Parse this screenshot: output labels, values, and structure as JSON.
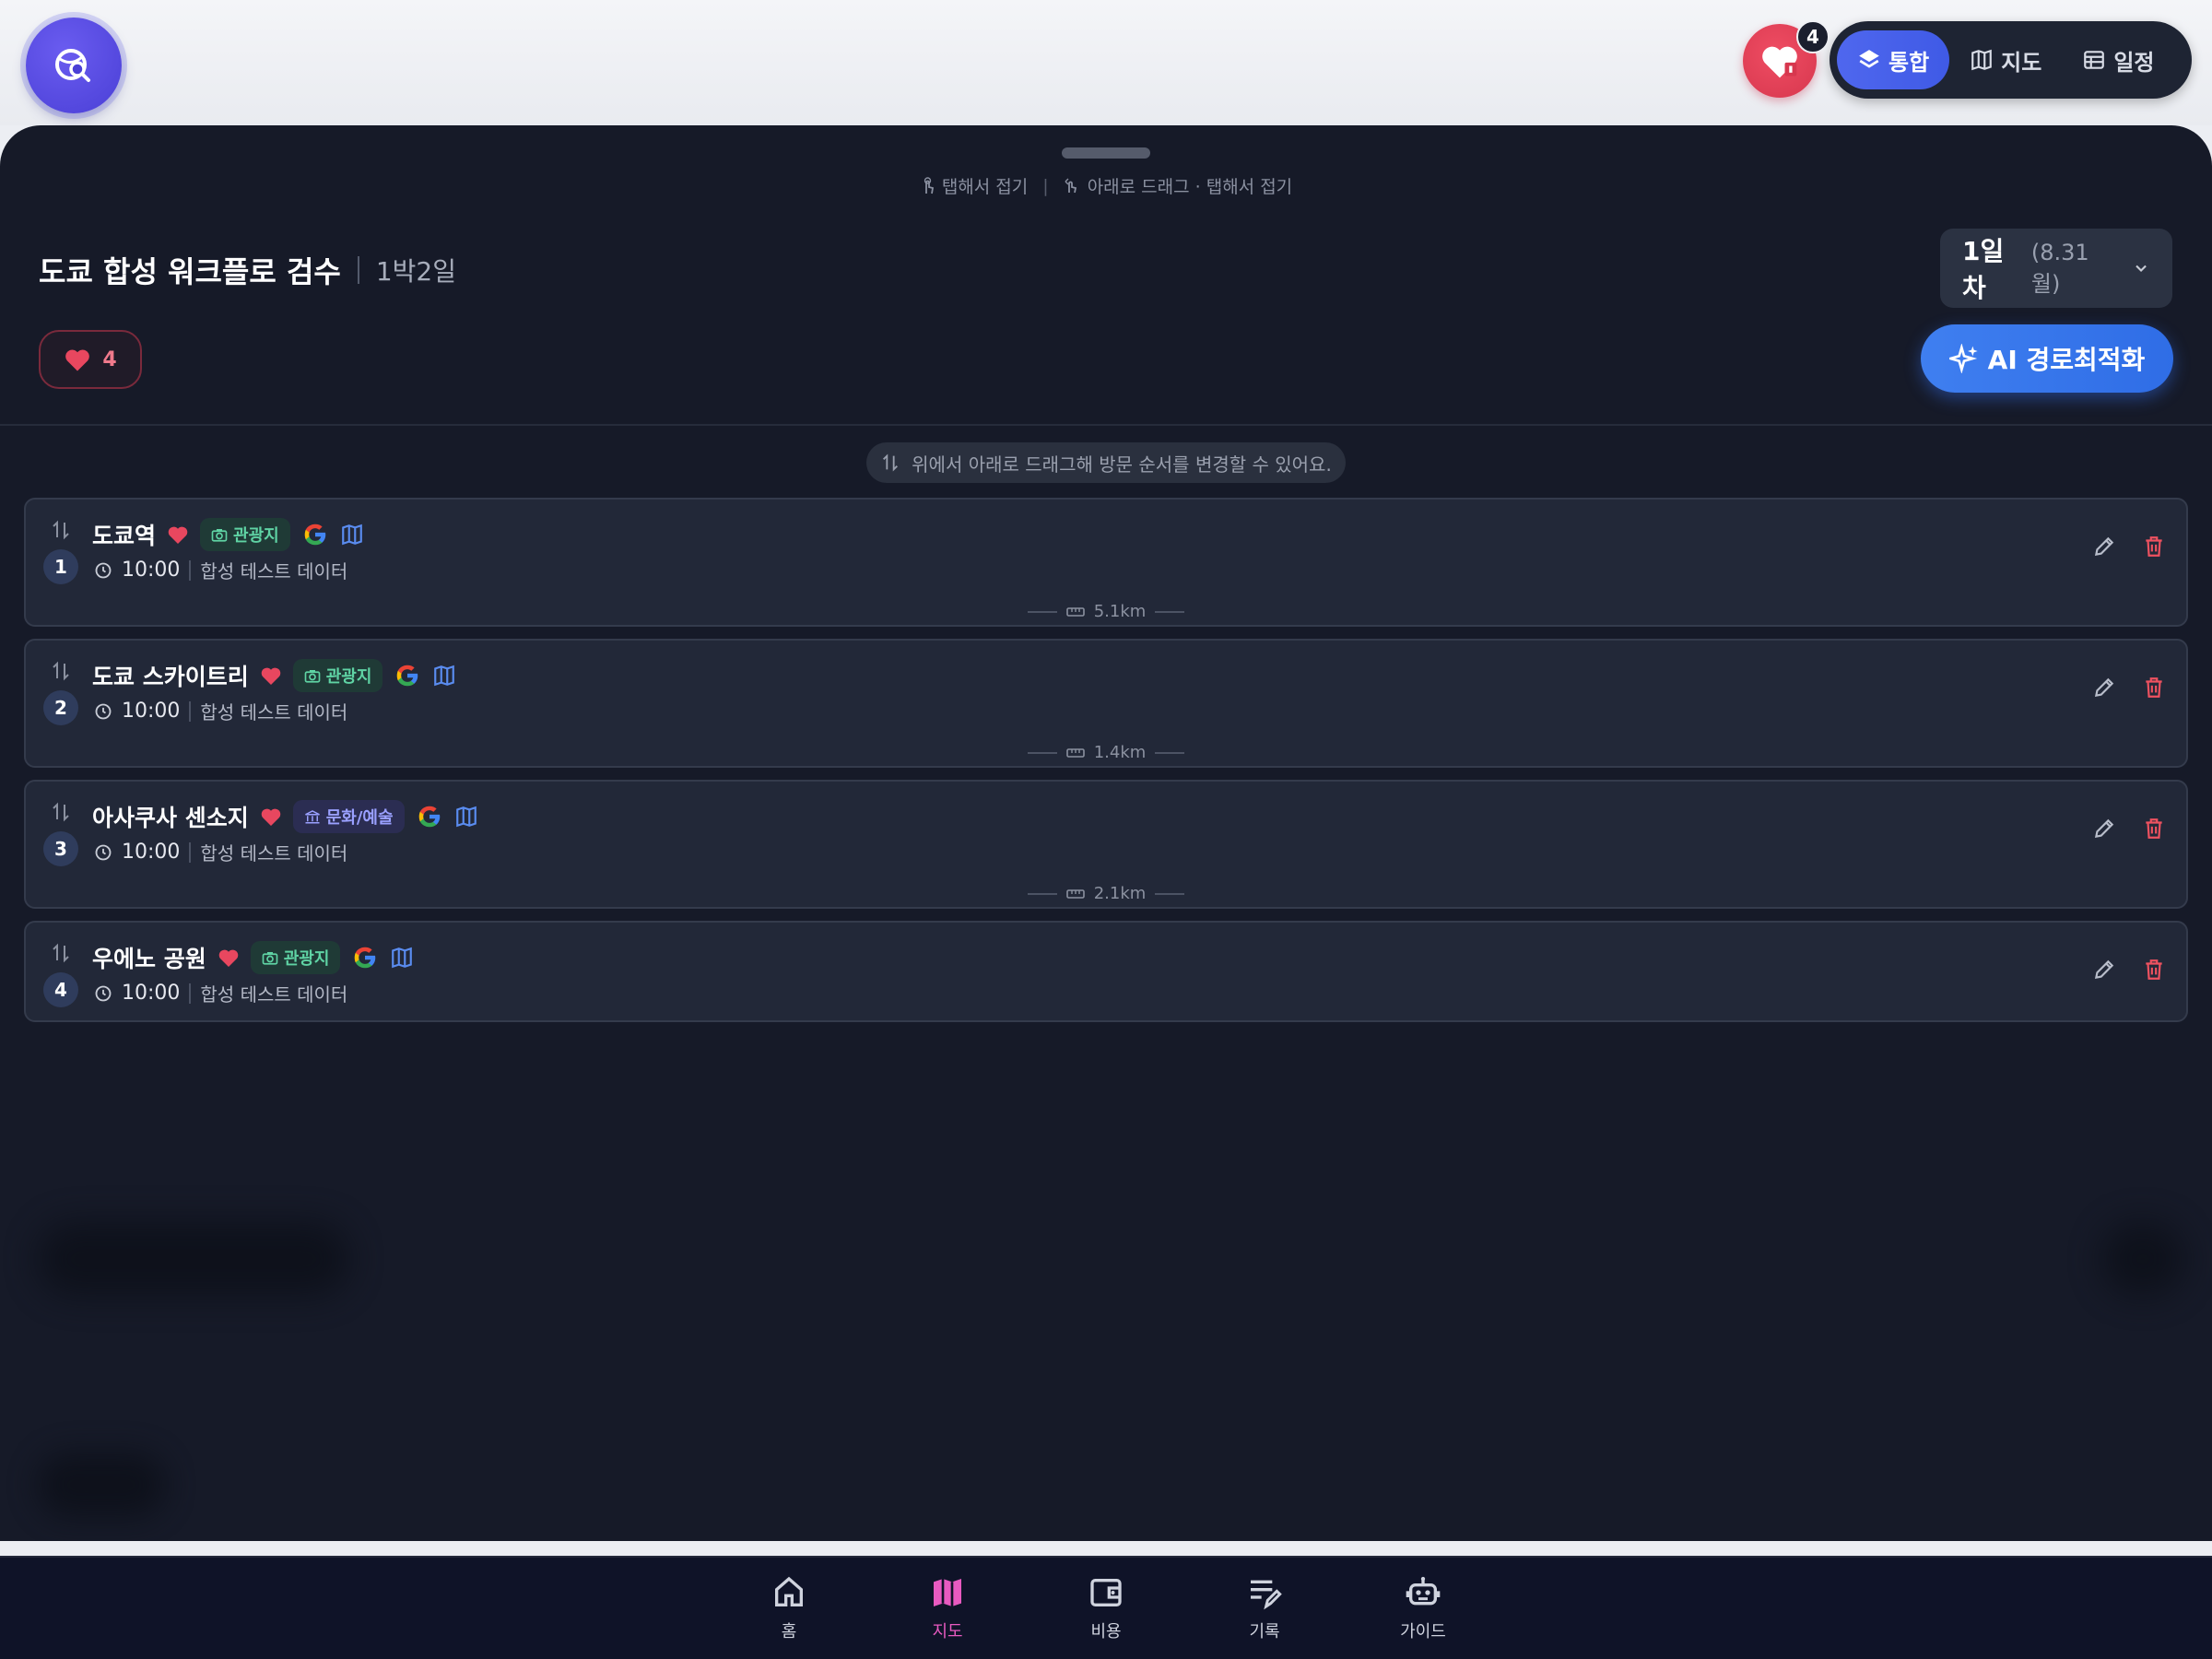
{
  "topbar": {
    "favorites_count": "4",
    "segments": [
      {
        "label": "통합",
        "icon": "layers-icon",
        "active": true
      },
      {
        "label": "지도",
        "icon": "map-icon",
        "active": false
      },
      {
        "label": "일정",
        "icon": "table-icon",
        "active": false
      }
    ]
  },
  "sheet": {
    "hint_tap": "탭해서 접기",
    "hint_drag": "아래로 드래그 · 탭해서 접기",
    "title": "도쿄 합성 워크플로 검수",
    "duration": "1박2일",
    "day_label": "1일차",
    "day_date": "(8.31 월)",
    "like_count": "4",
    "ai_button": "AI 경로최적화",
    "drag_hint": "위에서 아래로 드래그해 방문 순서를 변경할 수 있어요."
  },
  "places": [
    {
      "num": "1",
      "name": "도쿄역",
      "tag": "관광지",
      "tag_type": "sight",
      "time": "10:00",
      "desc": "합성 테스트 데이터",
      "distance": "5.1km"
    },
    {
      "num": "2",
      "name": "도쿄 스카이트리",
      "tag": "관광지",
      "tag_type": "sight",
      "time": "10:00",
      "desc": "합성 테스트 데이터",
      "distance": "1.4km"
    },
    {
      "num": "3",
      "name": "아사쿠사 센소지",
      "tag": "문화/예술",
      "tag_type": "culture",
      "time": "10:00",
      "desc": "합성 테스트 데이터",
      "distance": "2.1km"
    },
    {
      "num": "4",
      "name": "우에노 공원",
      "tag": "관광지",
      "tag_type": "sight",
      "time": "10:00",
      "desc": "합성 테스트 데이터",
      "distance": ""
    }
  ],
  "bottomnav": [
    {
      "label": "홈",
      "icon": "home-icon",
      "active": false
    },
    {
      "label": "지도",
      "icon": "map-icon",
      "active": true
    },
    {
      "label": "비용",
      "icon": "wallet-icon",
      "active": false
    },
    {
      "label": "기록",
      "icon": "notes-icon",
      "active": false
    },
    {
      "label": "가이드",
      "icon": "robot-icon",
      "active": false
    }
  ],
  "colors": {
    "accent": "#3f5ae6",
    "heart": "#e8475f",
    "nav_active": "#e85ac0",
    "sheet_bg": "#161a28"
  }
}
